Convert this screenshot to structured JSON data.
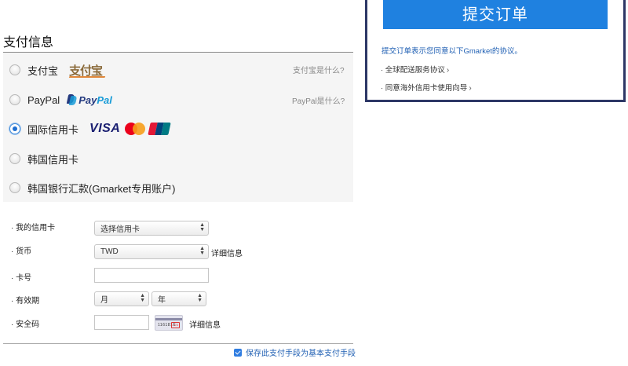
{
  "payment": {
    "title": "支付信息",
    "methods": [
      {
        "label": "支付宝",
        "logo": "支付宝",
        "help": "支付宝是什么?",
        "selected": false
      },
      {
        "label": "PayPal",
        "logo_a": "Pay",
        "logo_b": "Pal",
        "help": "PayPal是什么?",
        "selected": false
      },
      {
        "label": "国际信用卡",
        "logo": "VISA",
        "selected": true
      },
      {
        "label": "韩国信用卡",
        "selected": false
      },
      {
        "label": "韩国银行汇款(Gmarket专用账户)",
        "selected": false
      }
    ]
  },
  "form": {
    "my_card_label": "· 我的信用卡",
    "my_card_value": "选择信用卡",
    "currency_label": "· 货币",
    "currency_value": "TWD",
    "currency_detail": "详细信息",
    "card_no_label": "· 卡号",
    "expiry_label": "· 有效期",
    "month_value": "月",
    "year_value": "年",
    "cvv_label": "· 安全码",
    "cvv_card_digits": "1161816",
    "cvv_card_code": "123",
    "cvv_detail": "详细信息",
    "save_label": "保存此支付手段为基本支付手段",
    "save_checked": true
  },
  "side": {
    "submit_label": "提交订单",
    "agree_text": "提交订单表示您同意以下Gmarket的协议。",
    "links": [
      "· 全球配送服务协议",
      "· 同意海外信用卡使用向导"
    ],
    "chevron": "›"
  },
  "colors": {
    "accent": "#1f81e0",
    "panel_border": "#2d3766",
    "link": "#1f5fb3"
  }
}
